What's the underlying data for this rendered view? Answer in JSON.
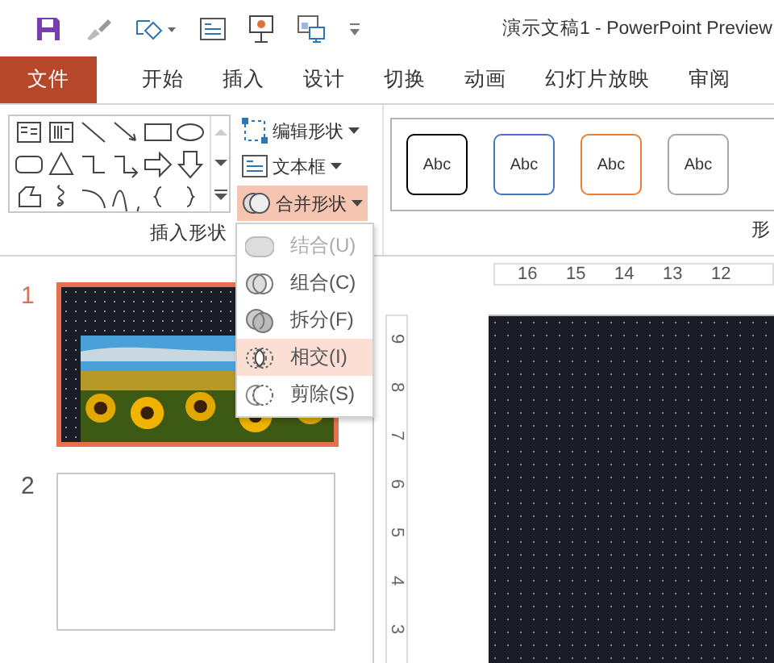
{
  "window": {
    "title": "演示文稿1 - PowerPoint Preview"
  },
  "tabs": [
    {
      "label": "文件",
      "kind": "file",
      "selected": false
    },
    {
      "label": "开始",
      "kind": "tab",
      "selected": false
    },
    {
      "label": "插入",
      "kind": "tab",
      "selected": false
    },
    {
      "label": "设计",
      "kind": "tab",
      "selected": false
    },
    {
      "label": "切换",
      "kind": "tab",
      "selected": false
    },
    {
      "label": "动画",
      "kind": "tab",
      "selected": false
    },
    {
      "label": "幻灯片放映",
      "kind": "tab",
      "selected": false
    },
    {
      "label": "审阅",
      "kind": "tab",
      "selected": false
    }
  ],
  "ribbon": {
    "insert_group": {
      "label": "插入形状",
      "buttons": [
        {
          "label": "编辑形状",
          "kind": "edit",
          "expanded": false
        },
        {
          "label": "文本框",
          "kind": "textbox",
          "expanded": false
        },
        {
          "label": "合并形状",
          "kind": "merge",
          "expanded": true
        }
      ]
    },
    "styles_group": {
      "label": "形",
      "styles": [
        {
          "label": "Abc",
          "color": "#000000"
        },
        {
          "label": "Abc",
          "color": "#4472c4"
        },
        {
          "label": "Abc",
          "color": "#ed7d31"
        },
        {
          "label": "Abc",
          "color": "#a5a5a5"
        }
      ]
    }
  },
  "merge_menu": [
    {
      "label": "结合(U)",
      "kind": "union",
      "disabled": true,
      "highlighted": false
    },
    {
      "label": "组合(C)",
      "kind": "combine",
      "disabled": false,
      "highlighted": false
    },
    {
      "label": "拆分(F)",
      "kind": "fragment",
      "disabled": false,
      "highlighted": false
    },
    {
      "label": "相交(I)",
      "kind": "intersect",
      "disabled": false,
      "highlighted": true
    },
    {
      "label": "剪除(S)",
      "kind": "subtract",
      "disabled": false,
      "highlighted": false
    }
  ],
  "slides": [
    {
      "number": "1",
      "selected": true,
      "kind": "picture"
    },
    {
      "number": "2",
      "selected": false,
      "kind": "blank"
    }
  ],
  "rulers": {
    "horizontal": [
      "16",
      "15",
      "14",
      "13",
      "12"
    ],
    "vertical": [
      "9",
      "8",
      "7",
      "6",
      "5",
      "4",
      "3"
    ]
  }
}
